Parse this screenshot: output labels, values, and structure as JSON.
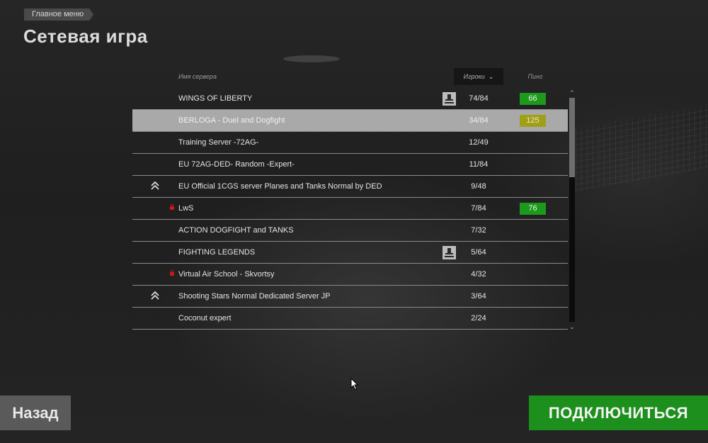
{
  "breadcrumb": "Главное меню",
  "title": "Сетевая игра",
  "columns": {
    "name": "Имя сервера",
    "players": "Игроки",
    "ping": "Пинг"
  },
  "colors": {
    "ping_good": "#1c9a1c",
    "ping_medium": "#a0a018",
    "connect_button": "#1c8f1c",
    "selected_row": "#a9a9a9"
  },
  "servers": [
    {
      "name": "WINGS OF LIBERTY",
      "players": "74/84",
      "ping": "66",
      "ping_level": "good",
      "locked": false,
      "rank_icon": false,
      "badge_icon": true,
      "selected": false
    },
    {
      "name": "BERLOGA - Duel and Dogfight",
      "players": "34/84",
      "ping": "125",
      "ping_level": "mid",
      "locked": false,
      "rank_icon": false,
      "badge_icon": false,
      "selected": true
    },
    {
      "name": "Training Server -72AG-",
      "players": "12/49",
      "ping": "",
      "ping_level": "",
      "locked": false,
      "rank_icon": false,
      "badge_icon": false,
      "selected": false
    },
    {
      "name": "EU 72AG-DED- Random -Expert-",
      "players": "11/84",
      "ping": "",
      "ping_level": "",
      "locked": false,
      "rank_icon": false,
      "badge_icon": false,
      "selected": false
    },
    {
      "name": "EU Official 1CGS server Planes and Tanks Normal by DED",
      "players": "9/48",
      "ping": "",
      "ping_level": "",
      "locked": false,
      "rank_icon": true,
      "badge_icon": false,
      "selected": false
    },
    {
      "name": "LwS",
      "players": "7/84",
      "ping": "76",
      "ping_level": "good",
      "locked": true,
      "rank_icon": false,
      "badge_icon": false,
      "selected": false
    },
    {
      "name": "ACTION DOGFIGHT and TANKS",
      "players": "7/32",
      "ping": "",
      "ping_level": "",
      "locked": false,
      "rank_icon": false,
      "badge_icon": false,
      "selected": false
    },
    {
      "name": "FIGHTING LEGENDS",
      "players": "5/64",
      "ping": "",
      "ping_level": "",
      "locked": false,
      "rank_icon": false,
      "badge_icon": true,
      "selected": false
    },
    {
      "name": "Virtual Air School - Skvortsy",
      "players": "4/32",
      "ping": "",
      "ping_level": "",
      "locked": true,
      "rank_icon": false,
      "badge_icon": false,
      "selected": false
    },
    {
      "name": "Shooting Stars Normal Dedicated Server JP",
      "players": "3/64",
      "ping": "",
      "ping_level": "",
      "locked": false,
      "rank_icon": true,
      "badge_icon": false,
      "selected": false
    },
    {
      "name": "Coconut expert",
      "players": "2/24",
      "ping": "",
      "ping_level": "",
      "locked": false,
      "rank_icon": false,
      "badge_icon": false,
      "selected": false
    }
  ],
  "buttons": {
    "back": "Назад",
    "connect": "ПОДКЛЮЧИТЬСЯ"
  }
}
